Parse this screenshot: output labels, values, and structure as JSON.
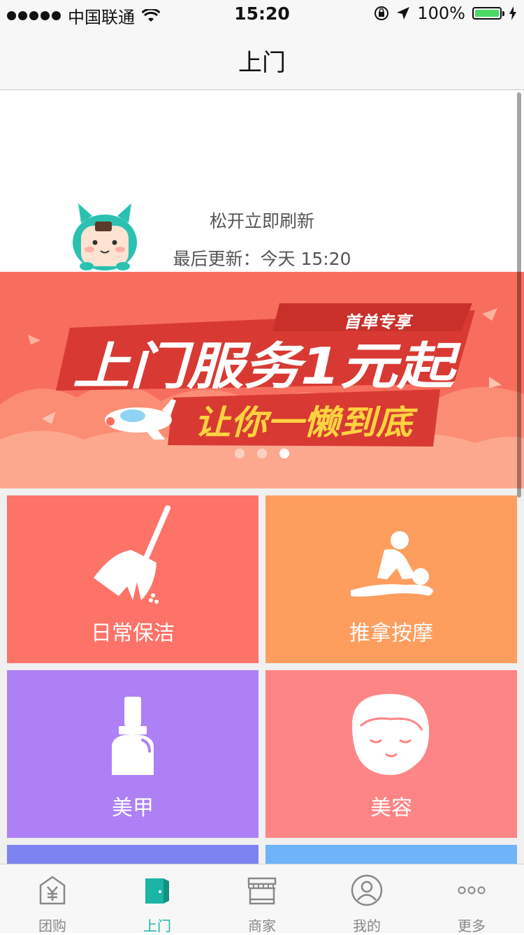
{
  "status_bar": {
    "carrier": "中国联通",
    "time": "15:20",
    "battery": "100%"
  },
  "nav": {
    "title": "上门"
  },
  "refresh": {
    "release_text": "松开立即刷新",
    "last_update": "最后更新：今天 15:20"
  },
  "banner": {
    "tag": "首单专享",
    "headline": "上门服务1元起",
    "subline": "让你一懒到底",
    "page_count": 3,
    "active_page": 3
  },
  "services": [
    {
      "label": "日常保洁",
      "icon": "broom-icon",
      "color": "#fe7368"
    },
    {
      "label": "推拿按摩",
      "icon": "massage-icon",
      "color": "#fe9e5e"
    },
    {
      "label": "美甲",
      "icon": "nail-polish-icon",
      "color": "#ad80f5"
    },
    {
      "label": "美容",
      "icon": "face-mask-icon",
      "color": "#fe8585"
    }
  ],
  "tabs": [
    {
      "label": "团购",
      "icon": "group-buy-icon",
      "active": false
    },
    {
      "label": "上门",
      "icon": "door-icon",
      "active": true
    },
    {
      "label": "商家",
      "icon": "store-icon",
      "active": false
    },
    {
      "label": "我的",
      "icon": "profile-icon",
      "active": false
    },
    {
      "label": "更多",
      "icon": "more-icon",
      "active": false
    }
  ],
  "colors": {
    "accent": "#1ab5a6",
    "banner_bg": "#f86e5e",
    "banner_ribbon": "#d83a33",
    "banner_subline": "#ffd33f"
  }
}
